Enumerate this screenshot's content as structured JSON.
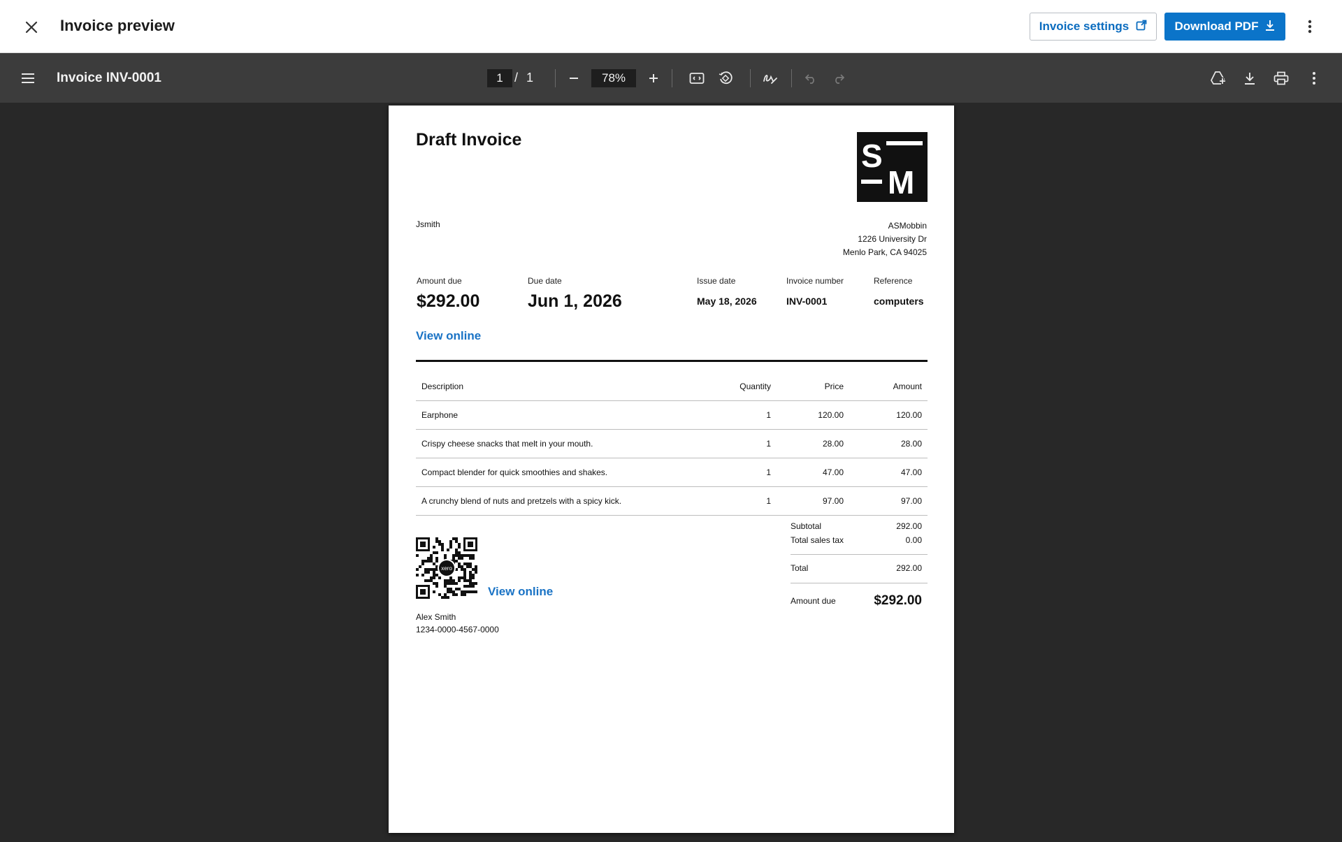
{
  "appbar": {
    "title": "Invoice preview",
    "settings_label": "Invoice settings",
    "download_label": "Download PDF"
  },
  "viewer": {
    "doc_title": "Invoice INV-0001",
    "current_page": "1",
    "separator": "/",
    "total_pages": "1",
    "zoom": "78%"
  },
  "invoice": {
    "heading": "Draft Invoice",
    "logo_letters": "SM",
    "client": "Jsmith",
    "org": {
      "name": "ASMobbin",
      "address1": "1226 University Dr",
      "address2": "Menlo Park, CA 94025"
    },
    "meta": {
      "amount_due_label": "Amount due",
      "amount_due": "$292.00",
      "due_date_label": "Due date",
      "due_date": "Jun 1, 2026",
      "issue_date_label": "Issue date",
      "issue_date": "May 18, 2026",
      "invoice_number_label": "Invoice number",
      "invoice_number": "INV-0001",
      "reference_label": "Reference",
      "reference": "computers"
    },
    "view_online": "View online",
    "table": {
      "headers": [
        "Description",
        "Quantity",
        "Price",
        "Amount"
      ],
      "rows": [
        [
          "Earphone",
          "1",
          "120.00",
          "120.00"
        ],
        [
          "Crispy cheese snacks that melt in your mouth.",
          "1",
          "28.00",
          "28.00"
        ],
        [
          "Compact blender for quick smoothies and shakes.",
          "1",
          "47.00",
          "47.00"
        ],
        [
          "A crunchy blend of nuts and pretzels with a spicy kick.",
          "1",
          "97.00",
          "97.00"
        ]
      ]
    },
    "totals": {
      "subtotal_label": "Subtotal",
      "subtotal": "292.00",
      "tax_label": "Total sales tax",
      "tax": "0.00",
      "total_label": "Total",
      "total": "292.00",
      "amount_due_label": "Amount due",
      "amount_due": "$292.00"
    },
    "qr_badge": "xero",
    "payee": {
      "name": "Alex Smith",
      "account": "1234-0000-4567-0000"
    }
  }
}
